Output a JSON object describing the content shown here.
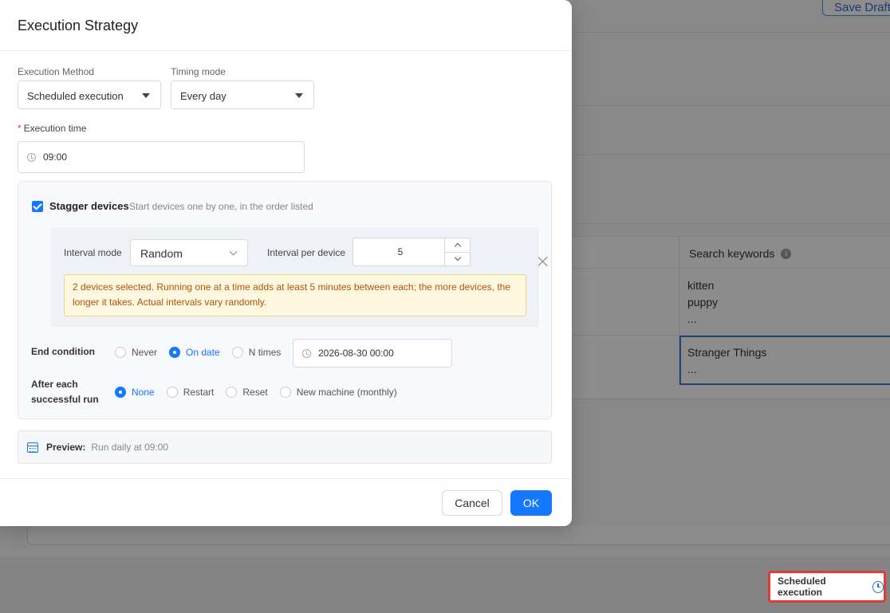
{
  "background": {
    "save_draft_label": "Save Draft",
    "table_header": "Search keywords",
    "rows": [
      {
        "lines": [
          "kitten",
          "puppy",
          "..."
        ]
      },
      {
        "lines": [
          "Stranger Things",
          "..."
        ]
      }
    ],
    "footer_badge": "Scheduled execution"
  },
  "modal": {
    "title": "Execution Strategy",
    "execution_method": {
      "label": "Execution Method",
      "value": "Scheduled execution"
    },
    "timing_mode": {
      "label": "Timing mode",
      "value": "Every day"
    },
    "execution_time": {
      "label": "Execution time",
      "required_mark": "*",
      "value": "09:00"
    },
    "stagger": {
      "checked": true,
      "title": "Stagger devices",
      "hint": "Start devices one by one, in the order listed",
      "interval_mode_label": "Interval mode",
      "interval_mode_value": "Random",
      "interval_per_device_label": "Interval per device",
      "interval_per_device_value": "5",
      "warning": "2 devices selected. Running one at a time adds at least 5 minutes between each; the more devices, the longer it takes. Actual intervals vary randomly."
    },
    "end_condition": {
      "label": "End condition",
      "options": [
        "Never",
        "On date",
        "N times"
      ],
      "selected": "On date",
      "date_value": "2026-08-30 00:00"
    },
    "after_run": {
      "label": "After each successful run",
      "options": [
        "None",
        "Restart",
        "Reset",
        "New machine (monthly)"
      ],
      "selected": "None"
    },
    "preview": {
      "label": "Preview:",
      "text": "Run daily at 09:00"
    },
    "cancel_label": "Cancel",
    "ok_label": "OK"
  },
  "colors": {
    "primary": "#1677ff",
    "warning_bg": "#fff8e1",
    "warning_text": "#b45309",
    "highlight": "#e53935"
  }
}
